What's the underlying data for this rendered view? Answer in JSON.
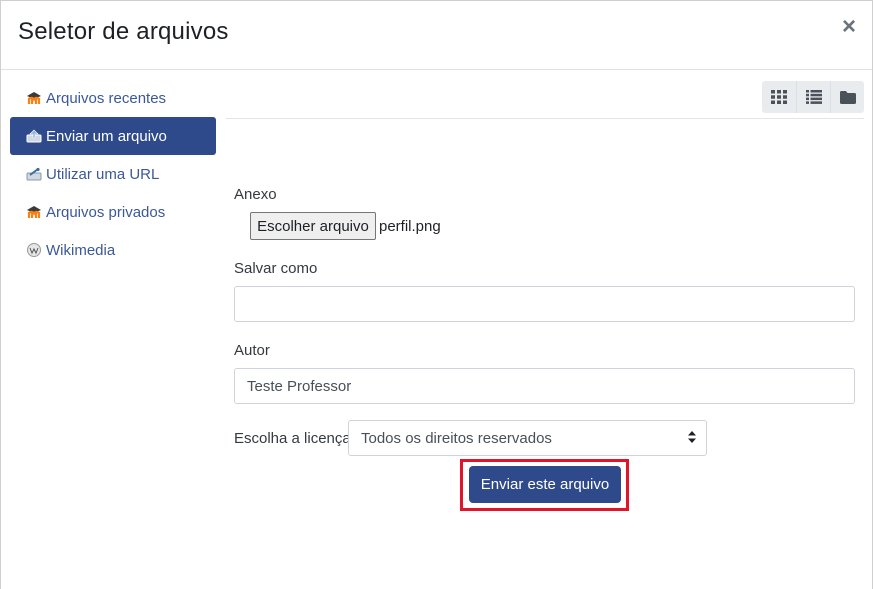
{
  "dialog": {
    "title": "Seletor de arquivos",
    "close_symbol": "×"
  },
  "sidebar": {
    "items": [
      {
        "label": "Arquivos recentes",
        "icon": "moodle-icon",
        "active": false
      },
      {
        "label": "Enviar um arquivo",
        "icon": "upload-icon",
        "active": true
      },
      {
        "label": "Utilizar uma URL",
        "icon": "url-icon",
        "active": false
      },
      {
        "label": "Arquivos privados",
        "icon": "moodle-icon",
        "active": false
      },
      {
        "label": "Wikimedia",
        "icon": "wikimedia-icon",
        "active": false
      }
    ]
  },
  "toolbar": {
    "views": [
      "grid-view-icon",
      "list-view-icon",
      "folder-view-icon"
    ]
  },
  "form": {
    "attachment_label": "Anexo",
    "choose_file_label": "Escolher arquivo",
    "chosen_file": "perfil.png",
    "save_as_label": "Salvar como",
    "save_as_value": "",
    "author_label": "Autor",
    "author_value": "Teste Professor",
    "license_label": "Escolha a licença",
    "license_value": "Todos os direitos reservados",
    "submit_label": "Enviar este arquivo"
  },
  "colors": {
    "accent": "#2f4a8a",
    "highlight": "#e3142a",
    "link": "#3b5998"
  }
}
